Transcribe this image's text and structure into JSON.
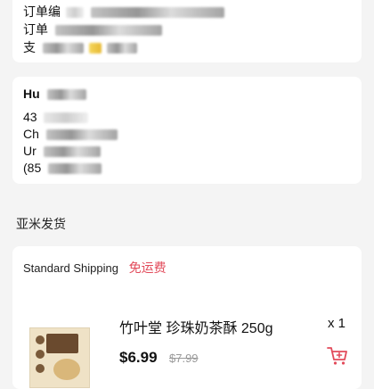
{
  "order_info": {
    "line1_label": "订单编",
    "line2_label": "订单",
    "line3_label": "支"
  },
  "address": {
    "name_visible": "Hu",
    "line1_visible": "43",
    "line2_visible": "Ch",
    "line3_visible": "Ur",
    "phone_visible": "(85"
  },
  "section": {
    "title": "亚米发货"
  },
  "shipping": {
    "method": "Standard Shipping",
    "fee_label": "免运费"
  },
  "product": {
    "title": "竹叶堂 珍珠奶茶酥 250g",
    "quantity": "x 1",
    "price": "$6.99",
    "original_price": "$7.99"
  },
  "colors": {
    "accent_red": "#e24b5b",
    "background": "#f4f4f4",
    "card": "#ffffff"
  },
  "icons": {
    "cart": "add-to-cart-icon"
  }
}
